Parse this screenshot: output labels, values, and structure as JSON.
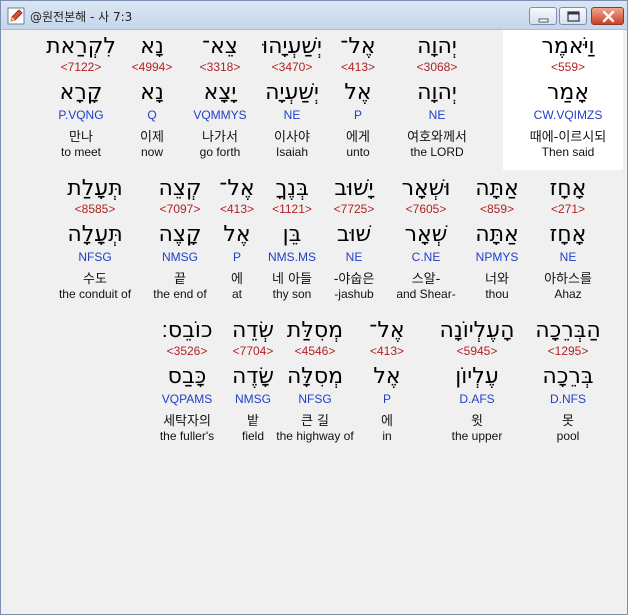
{
  "window": {
    "title": "@원전본해 - 사 7:3",
    "icon": "edit-pencil-icon",
    "title_color": "#c5d6ea"
  },
  "colors": {
    "strong": "#b22222",
    "morph": "#1f3fc8",
    "text": "#111111",
    "selected_bg": "#ffffff"
  },
  "rows": [
    [
      {
        "surface": "וַיֹּאמֶר",
        "strong": "<559>",
        "lemma": "אָמַר",
        "morph": "CW.VQIMZS",
        "korean": "때에-이르시되",
        "english": "Then said",
        "selected": true
      },
      {
        "surface": "יְהוָה",
        "strong": "<3068>",
        "lemma": "יְהוָה",
        "morph": "NE",
        "korean": "여호와께서",
        "english": "the LORD"
      },
      {
        "surface": "אֶל־",
        "strong": "<413>",
        "lemma": "אֶל",
        "morph": "P",
        "korean": "에게",
        "english": "unto"
      },
      {
        "surface": "יְשַׁעְיָהוּ",
        "strong": "<3470>",
        "lemma": "יְשַׁעְיָה",
        "morph": "NE",
        "korean": "이사야",
        "english": "Isaiah"
      },
      {
        "surface": "צֵא־",
        "strong": "<3318>",
        "lemma": "יָצָא",
        "morph": "VQMMYS",
        "korean": "나가서",
        "english": "go forth"
      },
      {
        "surface": "נָא",
        "strong": "<4994>",
        "lemma": "נָא",
        "morph": "Q",
        "korean": "이제",
        "english": "now"
      },
      {
        "surface": "לִקְרַאת",
        "strong": "<7122>",
        "lemma": "קָרָא",
        "morph": "P.VQNG",
        "korean": "만나",
        "english": "to meet"
      }
    ],
    [
      {
        "surface": "אָחָז",
        "strong": "<271>",
        "lemma": "אָחָז",
        "morph": "NE",
        "korean": "아하스를",
        "english": "Ahaz"
      },
      {
        "surface": "אַתָּה",
        "strong": "<859>",
        "lemma": "אַתָּה",
        "morph": "NPMYS",
        "korean": "너와",
        "english": "thou"
      },
      {
        "surface": "וּשְׁאָר",
        "strong": "<7605>",
        "lemma": "שְׁאָר",
        "morph": "C.NE",
        "korean": "스알-",
        "english": "and Shear-"
      },
      {
        "surface": "יָשׁוּב",
        "strong": "<7725>",
        "lemma": "שׁוּב",
        "morph": "NE",
        "korean": "-야숩은",
        "english": "-jashub"
      },
      {
        "surface": "בְּנֶךָ",
        "strong": "<1121>",
        "lemma": "בֵּן",
        "morph": "NMS.MS",
        "korean": "네 아들",
        "english": "thy son"
      },
      {
        "surface": "אֶל־",
        "strong": "<413>",
        "lemma": "אֶל",
        "morph": "P",
        "korean": "에",
        "english": "at"
      },
      {
        "surface": "קְצֵה",
        "strong": "<7097>",
        "lemma": "קָצֶה",
        "morph": "NMSG",
        "korean": "끝",
        "english": "the end of"
      },
      {
        "surface": "תְּעָלַת",
        "strong": "<8585>",
        "lemma": "תְּעָלָה",
        "morph": "NFSG",
        "korean": "수도",
        "english": "the conduit of"
      }
    ],
    [
      {
        "surface": "הַבְּרֵכָה",
        "strong": "<1295>",
        "lemma": "בְּרֵכָה",
        "morph": "D.NFS",
        "korean": "못",
        "english": "pool"
      },
      {
        "surface": "הָעֶלְיוֹנָה",
        "strong": "<5945>",
        "lemma": "עֶלְיוֹן",
        "morph": "D.AFS",
        "korean": "윗",
        "english": "the upper"
      },
      {
        "surface": "אֶל־",
        "strong": "<413>",
        "lemma": "אֶל",
        "morph": "P",
        "korean": "에",
        "english": "in"
      },
      {
        "surface": "מְסִלַּת",
        "strong": "<4546>",
        "lemma": "מְסִלָּה",
        "morph": "NFSG",
        "korean": "큰 길",
        "english": "the highway of"
      },
      {
        "surface": "שְׂדֵה",
        "strong": "<7704>",
        "lemma": "שָׂדֶה",
        "morph": "NMSG",
        "korean": "밭",
        "english": "field"
      },
      {
        "surface": "כוֹבֵס׃",
        "strong": "<3526>",
        "lemma": "כָּבַס",
        "morph": "VQPAMS",
        "korean": "세탁자의",
        "english": "the fuller's"
      }
    ]
  ]
}
